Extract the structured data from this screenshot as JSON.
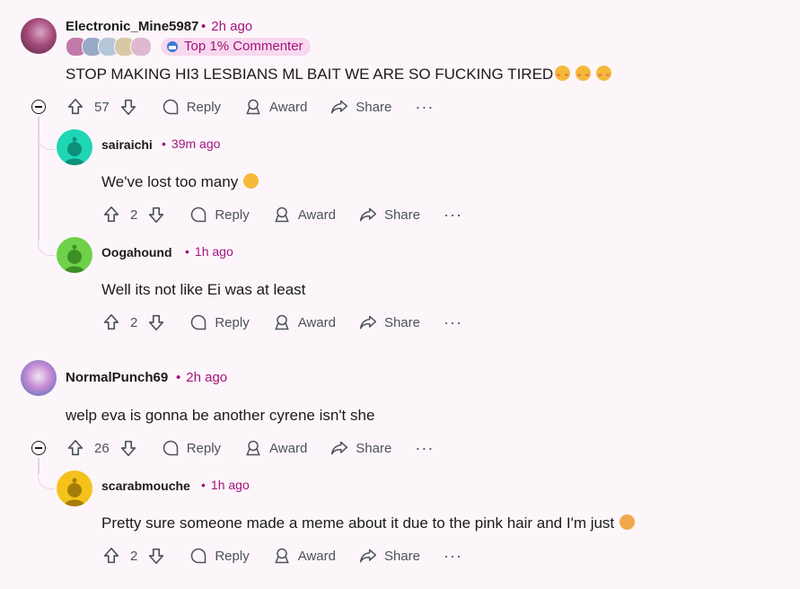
{
  "comments": [
    {
      "username": "Electronic_Mine5987",
      "time": "2h ago",
      "flair": "Top 1% Commenter",
      "text": "STOP MAKING HI3 LESBIANS ML BAIT WE ARE SO FUCKING TIRED",
      "emoji": [
        "flushed-face",
        "flushed-face",
        "flushed-face"
      ],
      "votes": "57",
      "reply": "Reply",
      "award": "Award",
      "share": "Share",
      "replies": [
        {
          "username": "sairaichi",
          "time": "39m ago",
          "text": "We've lost too many",
          "emoji": [
            "pensive-face"
          ],
          "votes": "2",
          "reply": "Reply",
          "award": "Award",
          "share": "Share"
        },
        {
          "username": "Oogahound",
          "time": "1h ago",
          "text": "Well its not like Ei was at least",
          "votes": "2",
          "reply": "Reply",
          "award": "Award",
          "share": "Share"
        }
      ]
    },
    {
      "username": "NormalPunch69",
      "time": "2h ago",
      "text": "welp eva is gonna be another cyrene isn't she",
      "votes": "26",
      "reply": "Reply",
      "award": "Award",
      "share": "Share",
      "replies": [
        {
          "username": "scarabmouche",
          "time": "1h ago",
          "text": "Pretty sure someone made a meme about it due to the pink hair and I'm just",
          "emoji": [
            "crying-face"
          ],
          "votes": "2",
          "reply": "Reply",
          "award": "Award",
          "share": "Share"
        }
      ]
    }
  ],
  "colors": {
    "accent": "#a3137b",
    "background": "#fcf6fb",
    "snoo_teal": "#1ed6b4",
    "snoo_green": "#6fd14a",
    "snoo_yellow": "#f4c21b"
  }
}
